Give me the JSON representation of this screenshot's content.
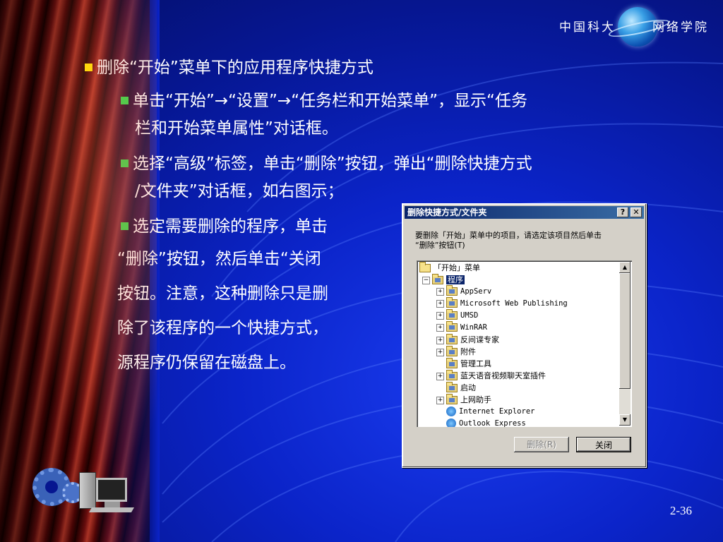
{
  "logo": {
    "left_text": "中国科大",
    "right_text": "网络学院"
  },
  "content": {
    "heading": "删除“开始”菜单下的应用程序快捷方式",
    "step1_line1": "单击“开始”→“设置”→“任务栏和开始菜单”，显示“任务",
    "step1_line2": "栏和开始菜单属性”对话框。",
    "step2_line1": "选择“高级”标签，单击“删除”按钮，弹出“删除快捷方式",
    "step2_line2": "/文件夹”对话框，如右图示；",
    "step3_line1": "选定需要删除的程序，单击",
    "step3_line2": "“删除”按钮，然后单击“关闭",
    "step3_line3": "按钮。注意，这种删除只是删",
    "step3_line4": "除了该程序的一个快捷方式，",
    "step3_line5": "源程序仍保留在磁盘上。"
  },
  "dialog": {
    "title": "删除快捷方式/文件夹",
    "help_button": "?",
    "close_button": "✕",
    "description_line1": "要删除「开始」菜单中的项目，请选定该项目然后单击",
    "description_line2": "“删除”按钮(T)",
    "tree": {
      "root": "「开始」菜单",
      "programs": "程序",
      "items": [
        "AppServ",
        "Microsoft Web Publishing",
        "UMSD",
        "WinRAR",
        "反间谍专家",
        "附件",
        "管理工具",
        "蓝天语音视频聊天室插件",
        "启动",
        "上网助手",
        "Internet Explorer",
        "Outlook Express"
      ]
    },
    "delete_button": "删除(R)",
    "close_label": "关闭"
  },
  "page_number": "2-36"
}
